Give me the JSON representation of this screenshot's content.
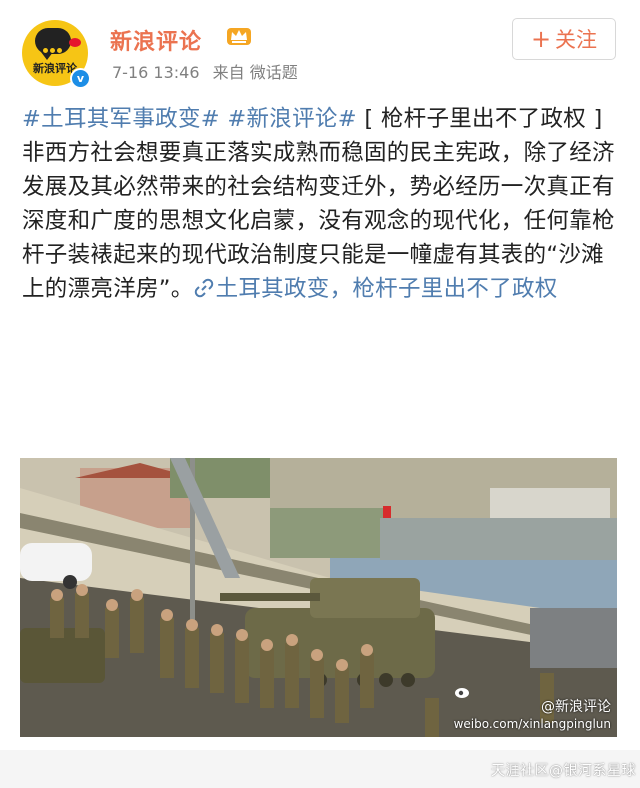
{
  "post": {
    "author": {
      "name": "新浪评论",
      "avatar_text": "新浪评论",
      "verified_mark": "v"
    },
    "time": "7-16 13:46",
    "source": "来自 微话题",
    "follow_label": "关注",
    "follow_icon": "+",
    "topics": [
      "#土耳其军事政变#",
      "#新浪评论#"
    ],
    "title": "[ 枪杆子里出不了政权 ]",
    "body": "非西方社会想要真正落实成熟而稳固的民主宪政，除了经济发展及其必然带来的社会结构变迁外，势必经历一次真正有深度和广度的思想文化启蒙，没有观念的现代化，任何靠枪杆子装裱起来的现代政治制度只能是一幢虚有其表的“沙滩上的漂亮洋房”。",
    "link_text": "土耳其政变，枪杆子里出不了政权",
    "image": {
      "watermark_handle": "@新浪评论",
      "watermark_url": "weibo.com/xinlangpinglun"
    }
  },
  "page_watermark": "天涯社区@银河系星球",
  "colors": {
    "link": "#507daf",
    "username": "#eb7350",
    "meta": "#808080",
    "avatar_bg": "#f6c515"
  }
}
